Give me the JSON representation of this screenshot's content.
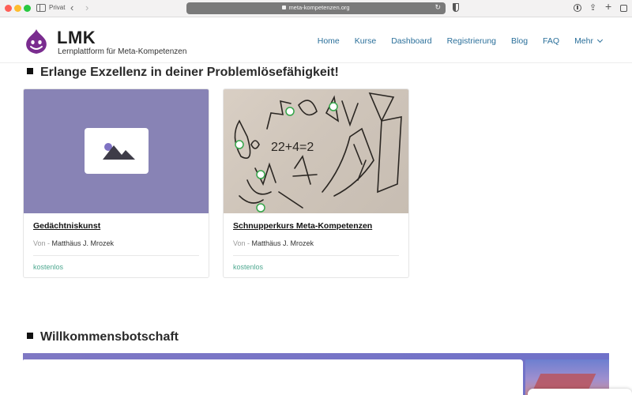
{
  "browser": {
    "private_label": "Privat",
    "url": "meta-kompetenzen.org"
  },
  "site": {
    "brand": "LMK",
    "tagline": "Lernplattform für Meta-Kompetenzen",
    "nav": [
      "Home",
      "Kurse",
      "Dashboard",
      "Registrierung",
      "Blog",
      "FAQ",
      "Mehr"
    ]
  },
  "sections": {
    "courses_title": "Erlange Exzellenz in deiner Problemlösefähigkeit!",
    "welcome_title": "Willkommensbotschaft"
  },
  "courses": [
    {
      "title": "Gedächtniskunst",
      "author_prefix": "Von -",
      "author": "Matthäus J. Mrozek",
      "price": "kostenlos",
      "thumbnail": "image-placeholder-icon"
    },
    {
      "title": "Schnupperkurs Meta-Kompetenzen",
      "author_prefix": "Von -",
      "author": "Matthäus J. Mrozek",
      "price": "kostenlos",
      "thumbnail": "sketch-photo"
    }
  ],
  "colors": {
    "nav_link": "#2a6f9a",
    "price": "#4ea890",
    "placeholder_bg": "#8883b5",
    "logo": "#7a2c8f",
    "banner": "#7f78c4"
  }
}
